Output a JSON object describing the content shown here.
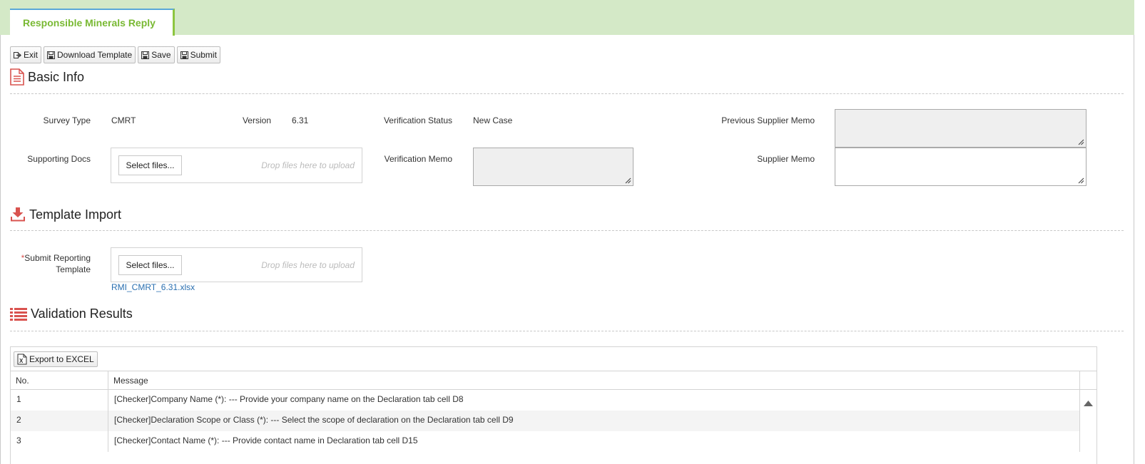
{
  "tab": {
    "title": "Responsible Minerals Reply"
  },
  "toolbar": {
    "exit": "Exit",
    "download_template": "Download Template",
    "save": "Save",
    "submit": "Submit"
  },
  "basic_info": {
    "title": "Basic Info",
    "survey_type_label": "Survey Type",
    "survey_type_value": "CMRT",
    "version_label": "Version",
    "version_value": "6.31",
    "verification_status_label": "Verification Status",
    "verification_status_value": "New Case",
    "previous_supplier_memo_label": "Previous Supplier Memo",
    "supporting_docs_label": "Supporting Docs",
    "verification_memo_label": "Verification Memo",
    "supplier_memo_label": "Supplier Memo",
    "select_files": "Select files...",
    "drop_hint": "Drop files here to upload"
  },
  "template_import": {
    "title": "Template Import",
    "required_mark": "*",
    "submit_label_line1": "Submit Reporting",
    "submit_label_line2": "Template",
    "select_files": "Select files...",
    "drop_hint": "Drop files here to upload",
    "file_link": "RMI_CMRT_6.31.xlsx"
  },
  "validation": {
    "title": "Validation Results",
    "export_label": "Export to EXCEL",
    "columns": {
      "no": "No.",
      "message": "Message"
    },
    "rows": [
      {
        "no": "1",
        "message": "[Checker]Company Name (*): --- Provide your company name on the Declaration tab cell D8"
      },
      {
        "no": "2",
        "message": "[Checker]Declaration Scope or Class (*): --- Select the scope of declaration on the Declaration tab cell D9"
      },
      {
        "no": "3",
        "message": "[Checker]Contact Name (*): --- Provide contact name in Declaration tab cell D15"
      }
    ]
  },
  "colors": {
    "tab_strip": "#d4e9c7",
    "tab_text": "#79b933",
    "icon_red": "#d9534f",
    "link": "#2a6fb0"
  }
}
